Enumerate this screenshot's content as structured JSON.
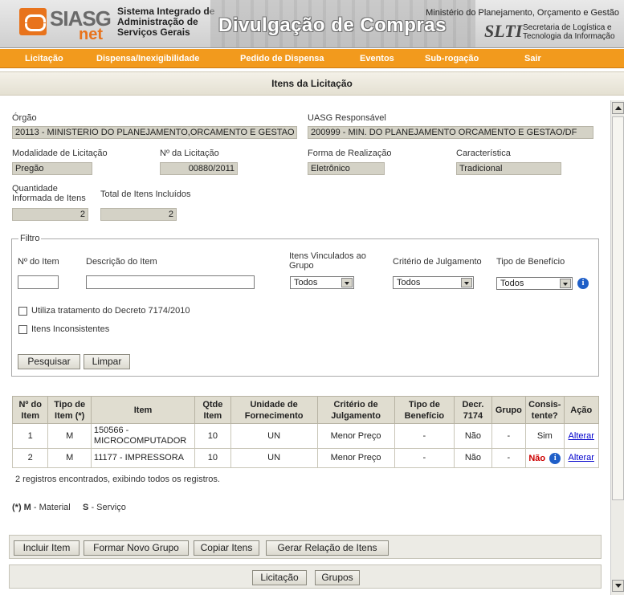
{
  "header": {
    "logo_siasg": "SIASG",
    "logo_net": "net",
    "system_name": "Sistema Integrado de Administração de Serviços Gerais",
    "banner_title": "Divulgação de Compras",
    "ministry": "Ministério do Planejamento, Orçamento e Gestão",
    "slti_logo": "SLTI",
    "slti_name": "Secretaria de Logística e Tecnologia da Informação"
  },
  "nav": [
    "Licitação",
    "Dispensa/Inexigibilidade",
    "Pedido de Dispensa",
    "Eventos",
    "Sub-rogação",
    "Sair"
  ],
  "page_title": "Itens da Licitação",
  "fields": {
    "orgao_label": "Órgão",
    "orgao_value": "20113 - MINISTERIO DO PLANEJAMENTO,ORCAMENTO E GESTAO",
    "uasg_label": "UASG Responsável",
    "uasg_value": "200999 - MIN. DO PLANEJAMENTO ORCAMENTO E GESTAO/DF",
    "modalidade_label": "Modalidade de Licitação",
    "modalidade_value": "Pregão",
    "numero_label": "Nº da Licitação",
    "numero_value": "00880/2011",
    "forma_label": "Forma de Realização",
    "forma_value": "Eletrônico",
    "caracteristica_label": "Característica",
    "caracteristica_value": "Tradicional",
    "qtd_label": "Quantidade Informada de Itens",
    "qtd_value": "2",
    "total_label": "Total de Itens Incluídos",
    "total_value": "2"
  },
  "filter": {
    "legend": "Filtro",
    "item_no_label": "Nº do Item",
    "item_no_value": "",
    "descricao_label": "Descrição do Item",
    "descricao_value": "",
    "vinculados_label": "Itens Vinculados ao Grupo",
    "vinculados_value": "Todos",
    "criterio_label": "Critério de Julgamento",
    "criterio_value": "Todos",
    "beneficio_label": "Tipo de Benefício",
    "beneficio_value": "Todos",
    "decreto_label": "Utiliza tratamento do Decreto 7174/2010",
    "inconsistentes_label": "Itens Inconsistentes",
    "pesquisar": "Pesquisar",
    "limpar": "Limpar"
  },
  "table": {
    "headers": [
      "Nº do Item",
      "Tipo de Item (*)",
      "Item",
      "Qtde Item",
      "Unidade de Fornecimento",
      "Critério de Julgamento",
      "Tipo de Benefício",
      "Decr. 7174",
      "Grupo",
      "Consis- tente?",
      "Ação"
    ],
    "rows": [
      {
        "num": "1",
        "tipo": "M",
        "item": "150566 - MICROCOMPUTADOR",
        "qtde": "10",
        "unidade": "UN",
        "criterio": "Menor Preço",
        "beneficio": "-",
        "decr": "Não",
        "grupo": "-",
        "consistente": "Sim",
        "acao": "Alterar"
      },
      {
        "num": "2",
        "tipo": "M",
        "item": "11177 - IMPRESSORA",
        "qtde": "10",
        "unidade": "UN",
        "criterio": "Menor Preço",
        "beneficio": "-",
        "decr": "Não",
        "grupo": "-",
        "consistente": "Não",
        "acao": "Alterar"
      }
    ],
    "summary": "2 registros encontrados, exibindo todos os registros."
  },
  "legend": {
    "star": "(*)",
    "m_key": "M",
    "m_desc": "- Material",
    "s_key": "S",
    "s_desc": "- Serviço"
  },
  "actions": {
    "incluir": "Incluir Item",
    "formar": "Formar Novo Grupo",
    "copiar": "Copiar Itens",
    "gerar": "Gerar Relação de Itens",
    "licitacao": "Licitação",
    "grupos": "Grupos"
  }
}
